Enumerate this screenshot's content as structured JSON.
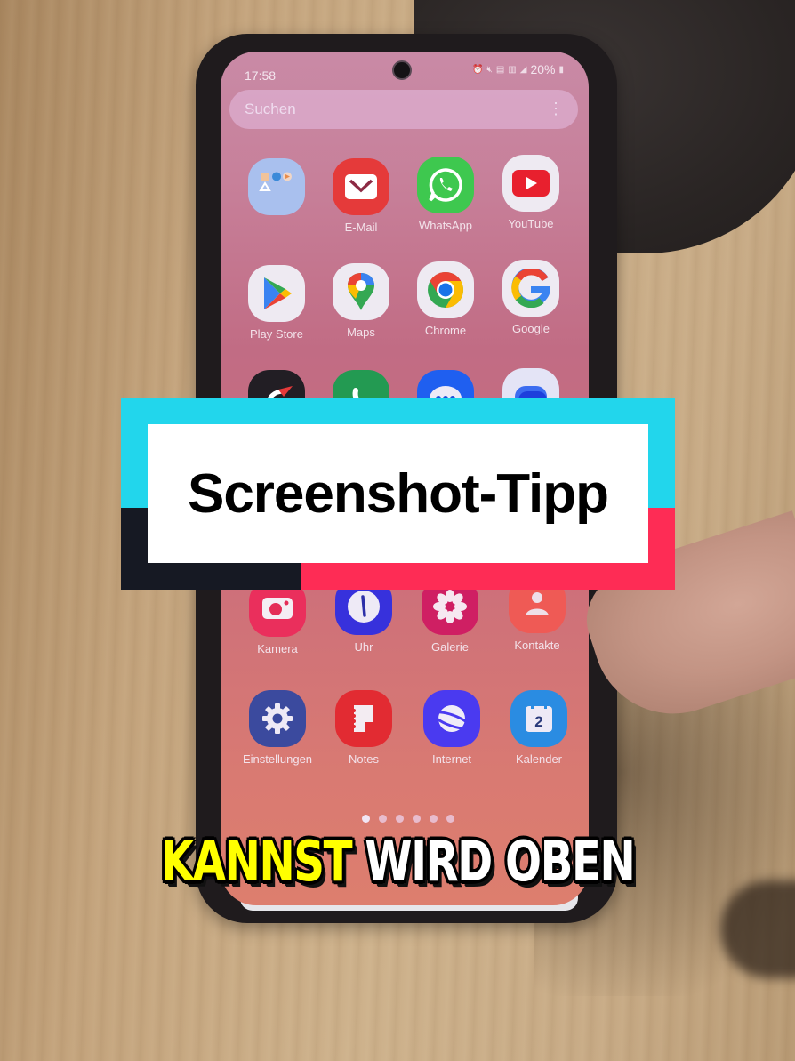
{
  "status_bar": {
    "time": "17:58",
    "battery": "20%",
    "icons": [
      "alarm-icon",
      "mute-icon",
      "volte-icon",
      "5g-icon",
      "signal-icon",
      "battery-icon"
    ]
  },
  "search": {
    "placeholder": "Suchen",
    "more_icon": "⋮"
  },
  "apps": [
    {
      "label": "",
      "icon": "folder-icon"
    },
    {
      "label": "E-Mail",
      "icon": "email-icon"
    },
    {
      "label": "WhatsApp",
      "icon": "whatsapp-icon"
    },
    {
      "label": "YouTube",
      "icon": "youtube-icon"
    },
    {
      "label": "Play Store",
      "icon": "play-store-icon"
    },
    {
      "label": "Maps",
      "icon": "maps-icon"
    },
    {
      "label": "Chrome",
      "icon": "chrome-icon"
    },
    {
      "label": "Google",
      "icon": "google-icon"
    },
    {
      "label": "",
      "icon": "game-launcher-icon"
    },
    {
      "label": "",
      "icon": "phone-icon"
    },
    {
      "label": "",
      "icon": "messages-icon"
    },
    {
      "label": "",
      "icon": "bixby-icon"
    },
    {
      "label": "Kamera",
      "icon": "camera-icon"
    },
    {
      "label": "Uhr",
      "icon": "clock-icon"
    },
    {
      "label": "Galerie",
      "icon": "gallery-icon"
    },
    {
      "label": "Kontakte",
      "icon": "contacts-icon"
    },
    {
      "label": "Einstellungen",
      "icon": "settings-icon"
    },
    {
      "label": "Notes",
      "icon": "notes-icon"
    },
    {
      "label": "Internet",
      "icon": "internet-icon"
    },
    {
      "label": "Kalender",
      "icon": "calendar-icon",
      "day": "2"
    }
  ],
  "page_indicator": {
    "total": 6,
    "active": 1
  },
  "banner": {
    "title": "Screenshot-Tipp",
    "colors": {
      "cyan": "#22d6ec",
      "red": "#fe2c55",
      "dark": "#161923"
    }
  },
  "subtitle": {
    "highlight": "KANNST",
    "rest": "WIRD OBEN",
    "highlight_color": "#ffff00"
  }
}
